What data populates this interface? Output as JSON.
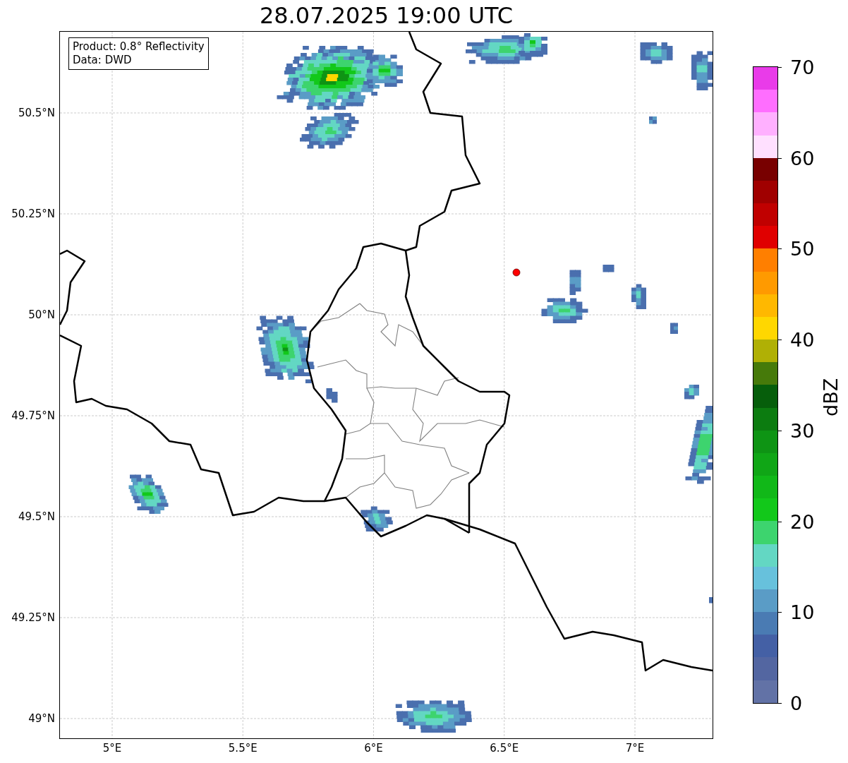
{
  "title": "28.07.2025 19:00 UTC",
  "map": {
    "longitude_labels": [
      "5°E",
      "5.5°E",
      "6°E",
      "6.5°E",
      "7°E"
    ],
    "latitude_labels": [
      "50.5°N",
      "50.25°N",
      "50°N",
      "49.75°N",
      "49.5°N",
      "49.25°N",
      "49°N"
    ]
  },
  "legend": {
    "lines": [
      "Product: 0.8° Reflectivity",
      "Data: DWD"
    ]
  },
  "colorbar": {
    "label": "dBZ",
    "ticks": [
      "70",
      "60",
      "50",
      "40",
      "30",
      "20",
      "10",
      "0"
    ],
    "bands": [
      {
        "color": "#e93be9"
      },
      {
        "color": "#ff6eff"
      },
      {
        "color": "#ffb0ff"
      },
      {
        "color": "#ffe0ff"
      },
      {
        "color": "#780000"
      },
      {
        "color": "#a00000"
      },
      {
        "color": "#c00000"
      },
      {
        "color": "#e00000"
      },
      {
        "color": "#ff7f00"
      },
      {
        "color": "#ff9a00"
      },
      {
        "color": "#ffb800"
      },
      {
        "color": "#ffd700"
      },
      {
        "color": "#b0b005"
      },
      {
        "color": "#467a0a"
      },
      {
        "color": "#065e0b"
      },
      {
        "color": "#0c7c10"
      },
      {
        "color": "#0e9414"
      },
      {
        "color": "#10a616"
      },
      {
        "color": "#11b818"
      },
      {
        "color": "#12c81a"
      },
      {
        "color": "#3dd46e"
      },
      {
        "color": "#63d7c3"
      },
      {
        "color": "#67c1dc"
      },
      {
        "color": "#5a9cc6"
      },
      {
        "color": "#4a7bb3"
      },
      {
        "color": "#4460a5"
      },
      {
        "color": "#5366a1"
      },
      {
        "color": "#6272a6"
      }
    ]
  }
}
